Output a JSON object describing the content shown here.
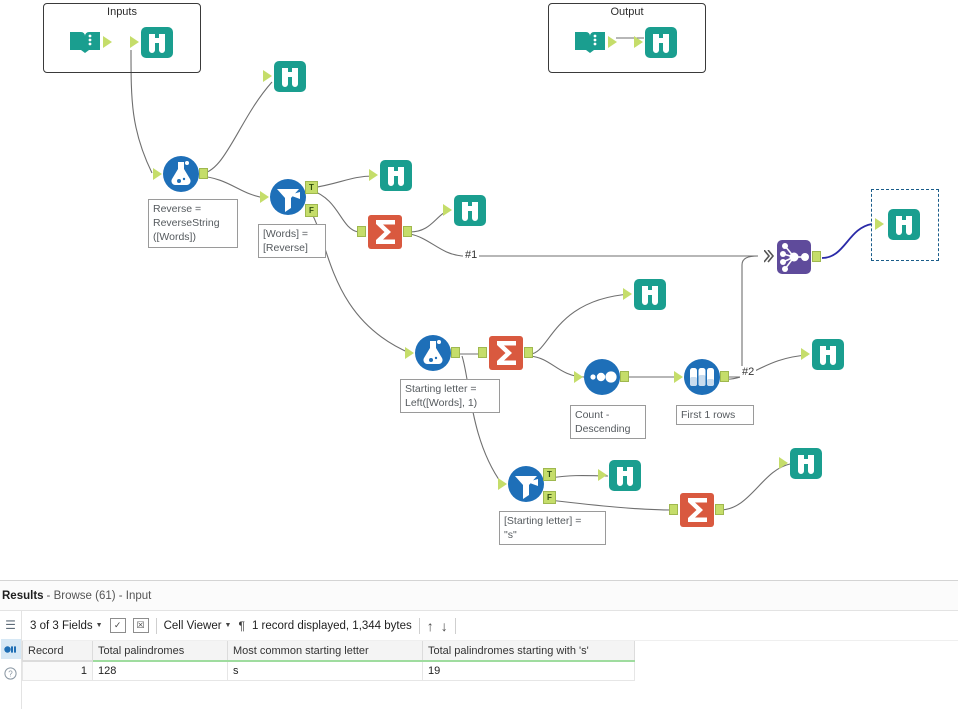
{
  "canvas": {
    "containers": [
      {
        "id": "inputs",
        "title": "Inputs"
      },
      {
        "id": "output",
        "title": "Output"
      }
    ],
    "wire_labels": [
      {
        "id": "w1",
        "text": "#1"
      },
      {
        "id": "w2",
        "text": "#2"
      }
    ],
    "annotations": [
      {
        "id": "a-formula-reverse",
        "text": "Reverse =\nReverseString\n([Words])"
      },
      {
        "id": "a-filter-words",
        "text": "[Words] =\n[Reverse]"
      },
      {
        "id": "a-formula-starting",
        "text": "Starting letter =\nLeft([Words], 1)"
      },
      {
        "id": "a-sort-count",
        "text": "Count -\nDescending"
      },
      {
        "id": "a-sample-first",
        "text": "First 1 rows"
      },
      {
        "id": "a-filter-s",
        "text": "[Starting letter] =\n\"s\""
      }
    ],
    "node_names": {
      "input_data": "input-data-tool",
      "browse": "browse-tool",
      "formula": "formula-tool",
      "filter": "filter-tool",
      "summarize": "summarize-tool",
      "sort": "sort-tool",
      "sample": "sample-tool",
      "join_multiple": "join-multiple-tool"
    },
    "filter_badges": {
      "true": "T",
      "false": "F"
    },
    "colors": {
      "teal": "#1a9e8f",
      "blue": "#1e6fb8",
      "orange": "#d9593f",
      "purple": "#5f4b9b",
      "anchor_green": "#c5dd6a",
      "selected_wire": "#2a2aa8",
      "selection_border": "#1a5c8a",
      "wire": "#6f6f6f"
    }
  },
  "results": {
    "header": {
      "label": "Results",
      "subtitle": "- Browse (61) - Input"
    },
    "rail": {
      "menu_icon": "hamburger-icon",
      "data_icon": "data-icon",
      "help_icon": "help-icon"
    },
    "toolbar": {
      "fields_selector": "3 of 3 Fields",
      "checkbox_icon": "checked-box-icon",
      "clear_icon": "clear-selection-icon",
      "view_mode": "Cell Viewer",
      "pilcrow_icon": "pilcrow-icon",
      "record_status": "1 record displayed, 1,344 bytes",
      "up_arrow_icon": "arrow-up-icon",
      "down_arrow_icon": "arrow-down-icon"
    },
    "table": {
      "columns": [
        "Record",
        "Total palindromes",
        "Most common starting letter",
        "Total palindromes starting with 's'"
      ],
      "rows": [
        {
          "record": "1",
          "total_palindromes": "128",
          "most_common_starting_letter": "s",
          "total_palindromes_s": "19"
        }
      ]
    }
  }
}
